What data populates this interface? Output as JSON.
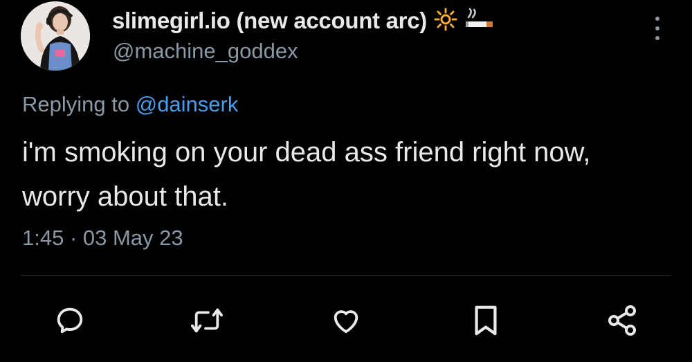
{
  "tweet": {
    "display_name": "slimegirl.io (new account arc)",
    "emojis": [
      "sun-emoji",
      "cigarette-emoji"
    ],
    "handle": "@machine_goddex",
    "reply_prefix": "Replying to",
    "reply_to": "@dainserk",
    "text": "i'm smoking on your dead ass friend right now, worry about that.",
    "timestamp": "1:45 · 03 May 23"
  },
  "actions": [
    {
      "name": "reply-icon"
    },
    {
      "name": "retweet-icon"
    },
    {
      "name": "like-icon"
    },
    {
      "name": "bookmark-icon"
    },
    {
      "name": "share-icon"
    }
  ],
  "colors": {
    "background": "#000000",
    "primary_text": "#e7e9ea",
    "secondary_text": "#8b98a5",
    "mention": "#4a9deb",
    "divider": "#2f3336"
  }
}
